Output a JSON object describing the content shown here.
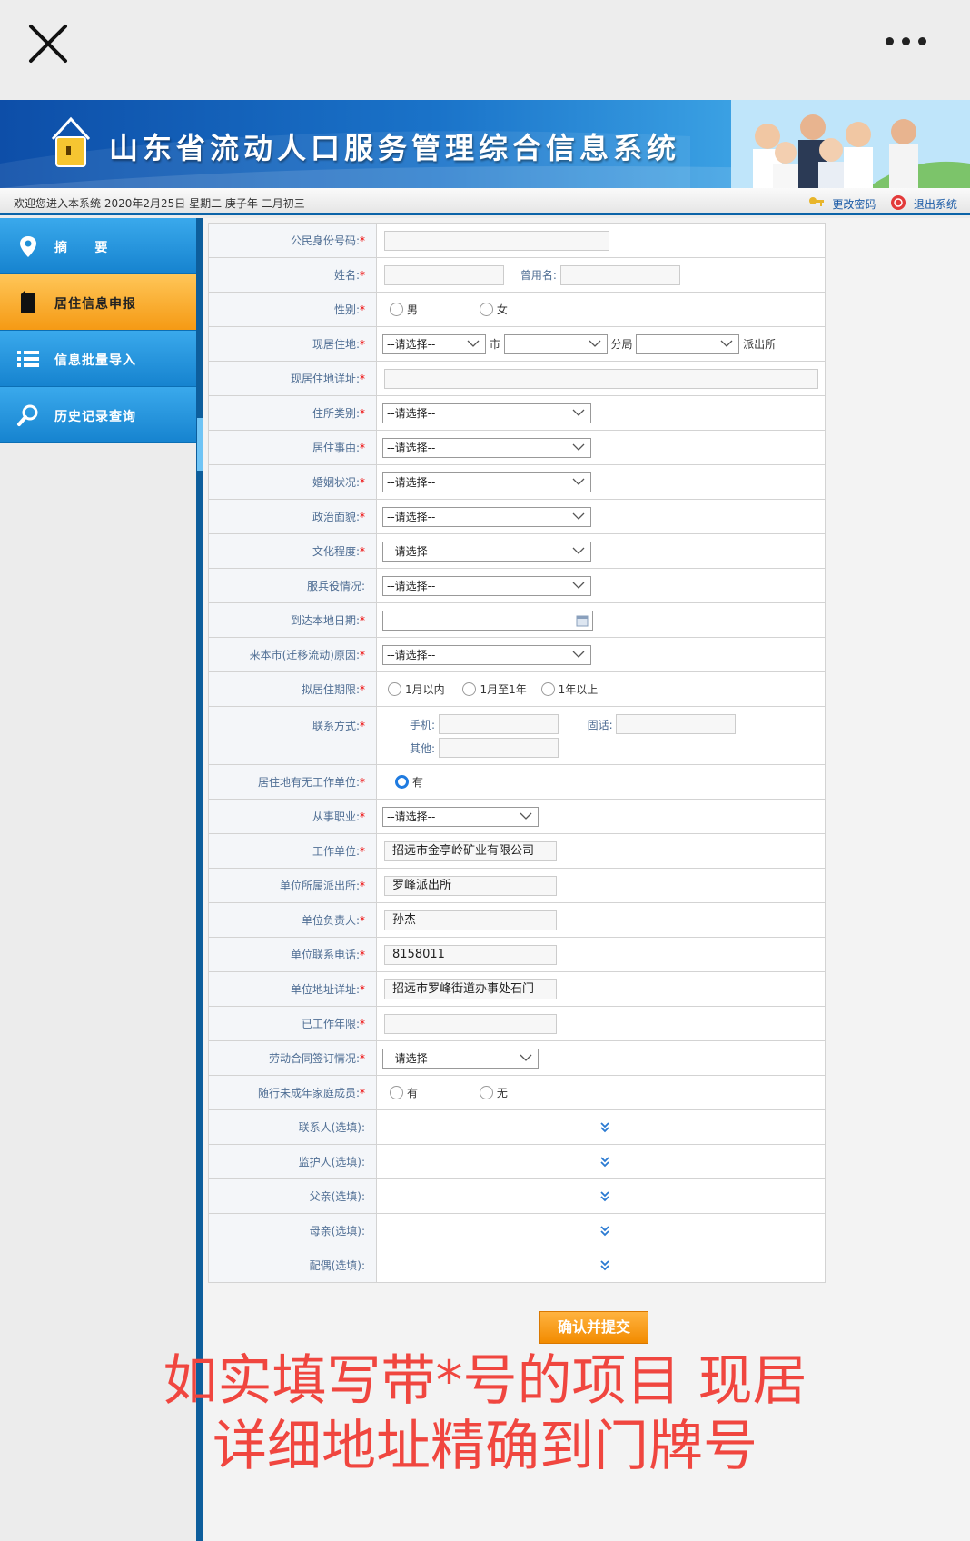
{
  "app_title": "山东省流动人口服务管理综合信息系统",
  "welcome": "欢迎您进入本系统 2020年2月25日 星期二 庚子年 二月初三",
  "account": {
    "change_password": "更改密码",
    "logout": "退出系统"
  },
  "sidebar": {
    "items": [
      {
        "label": "摘     要",
        "icon": "map-pin-icon"
      },
      {
        "label": "居住信息申报",
        "icon": "document-icon",
        "active": true
      },
      {
        "label": "信息批量导入",
        "icon": "list-icon"
      },
      {
        "label": "历史记录查询",
        "icon": "search-icon"
      }
    ]
  },
  "form": {
    "id_number": "公民身份号码:",
    "name": "姓名:",
    "former_name": "曾用名:",
    "gender": "性别:",
    "gender_male": "男",
    "gender_female": "女",
    "current_residence": "现居住地:",
    "select_placeholder": "--请选择--",
    "city": "市",
    "branch": "分局",
    "police_station": "派出所",
    "residence_detail": "现居住地详址:",
    "dwelling_type": "住所类别:",
    "residence_reason": "居住事由:",
    "marital_status": "婚姻状况:",
    "political_status": "政治面貌:",
    "education": "文化程度:",
    "military_service": "服兵役情况:",
    "arrival_date": "到达本地日期:",
    "migration_reason": "来本市(迁移流动)原因:",
    "planned_duration": "拟居住期限:",
    "duration_1": "1月以内",
    "duration_2": "1月至1年",
    "duration_3": "1年以上",
    "contact": "联系方式:",
    "mobile": "手机:",
    "landline": "固话:",
    "other": "其他:",
    "has_employer": "居住地有无工作单位:",
    "has_employer_yes": "有",
    "occupation": "从事职业:",
    "employer": "工作单位:",
    "employer_value": "招远市金亭岭矿业有限公司",
    "employer_station": "单位所属派出所:",
    "employer_station_value": "罗峰派出所",
    "employer_head": "单位负责人:",
    "employer_head_value": "孙杰",
    "employer_phone": "单位联系电话:",
    "employer_phone_value": "8158011",
    "employer_address": "单位地址详址:",
    "employer_address_value": "招远市罗峰街道办事处石门",
    "years_worked": "已工作年限:",
    "labor_contract": "劳动合同签订情况:",
    "minor_family": "随行未成年家庭成员:",
    "minor_yes": "有",
    "minor_no": "无",
    "contact_person": "联系人(选填):",
    "guardian": "监护人(选填):",
    "father": "父亲(选填):",
    "mother": "母亲(选填):",
    "spouse": "配偶(选填):"
  },
  "submit_label": "确认并提交",
  "overlay": {
    "line1": "如实填写带*号的项目  现居",
    "line2": "详细地址精确到门牌号"
  },
  "colors": {
    "sidebar": "#1f9ae0",
    "active": "#f59a14",
    "overlay_text": "#f0463f",
    "required": "#e00000"
  }
}
